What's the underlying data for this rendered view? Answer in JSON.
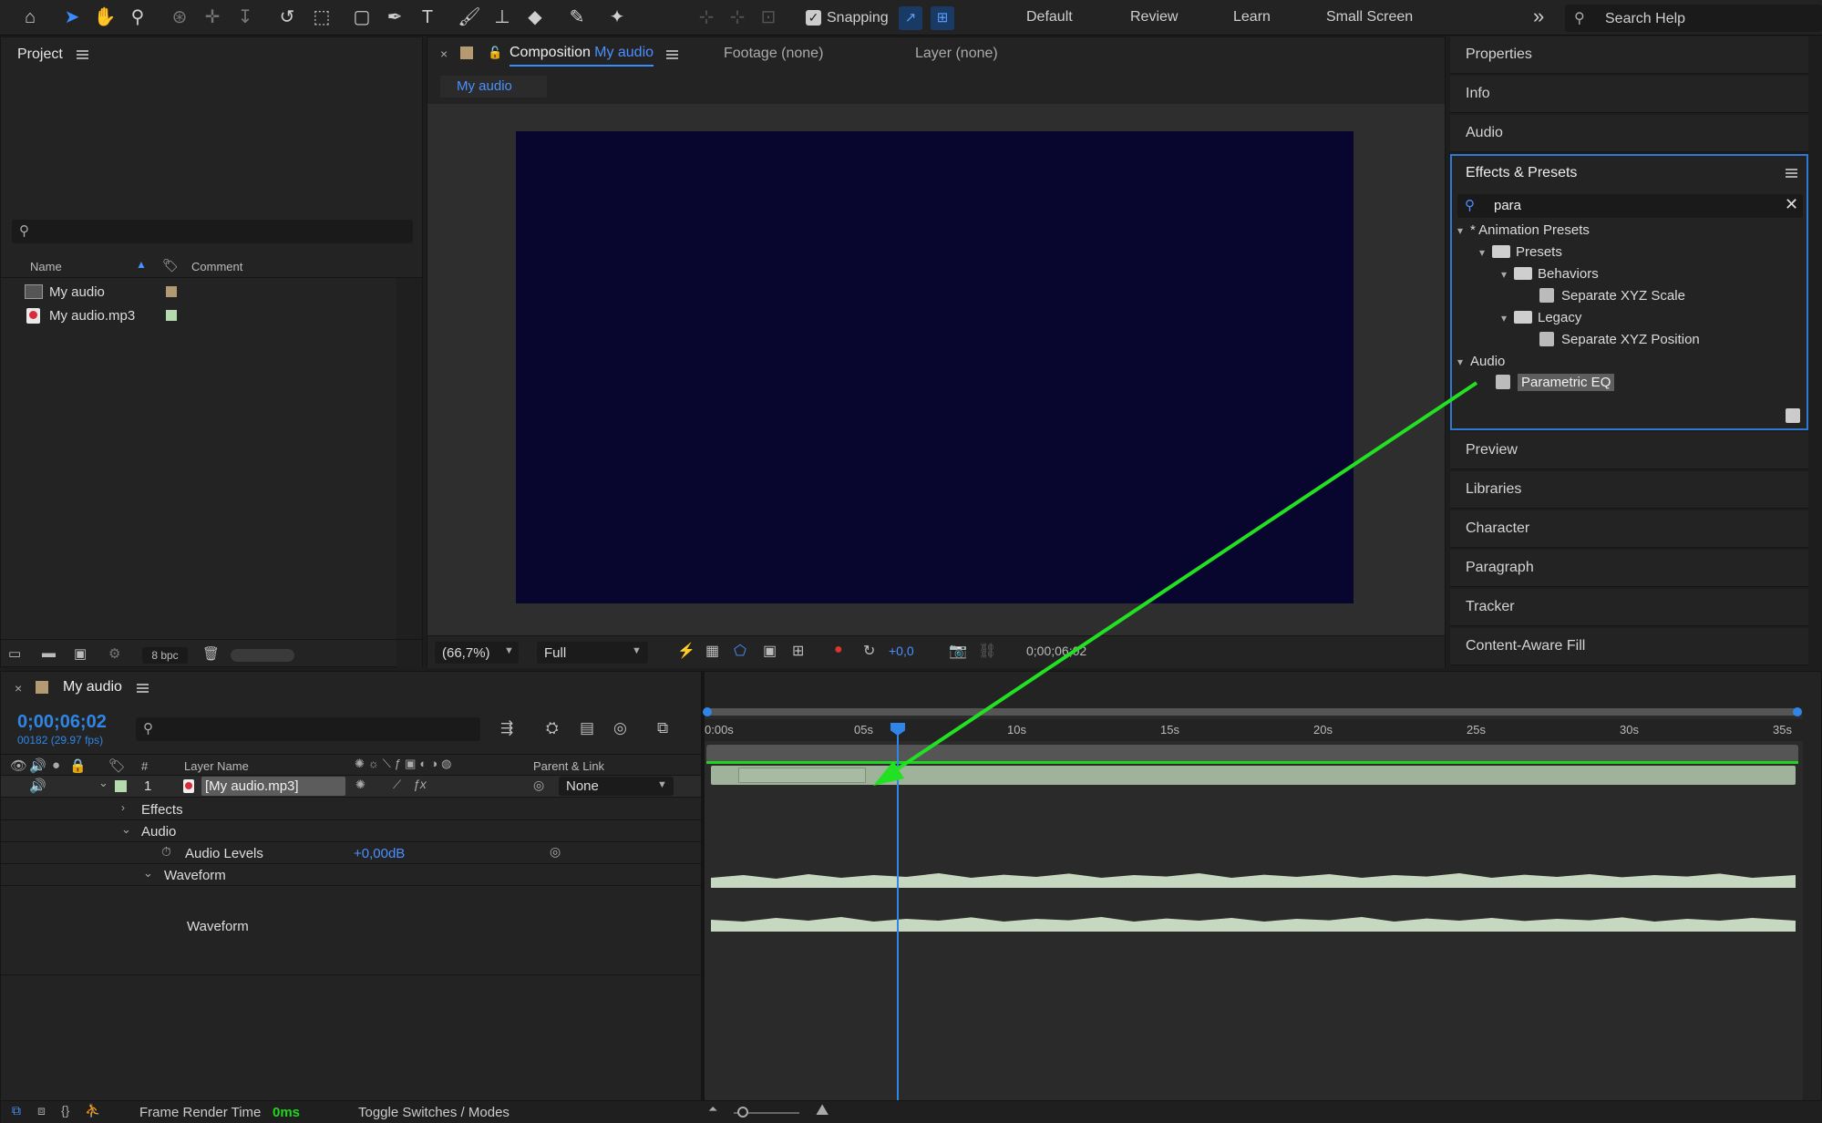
{
  "toolbar": {
    "snapping_label": "Snapping",
    "workspaces": [
      "Default",
      "Review",
      "Learn",
      "Small Screen"
    ],
    "more": "»",
    "search_placeholder": "Search Help"
  },
  "project": {
    "title": "Project",
    "columns": {
      "name": "Name",
      "comment": "Comment"
    },
    "items": [
      {
        "name": "My audio",
        "label_color": "#b39a72"
      },
      {
        "name": "My audio.mp3",
        "label_color": "#b7d9b0"
      }
    ],
    "bpc": "8 bpc"
  },
  "viewer": {
    "tabs": {
      "composition_prefix": "Composition",
      "composition_name": "My audio",
      "footage": "Footage (none)",
      "layer": "Layer (none)"
    },
    "comp_tab": "My audio",
    "zoom": "(66,7%)",
    "resolution": "Full",
    "exposure": "+0,0",
    "timecode": "0;00;06;02",
    "canvas_color": "#08062e"
  },
  "right_panels": {
    "properties": "Properties",
    "info": "Info",
    "audio": "Audio",
    "effects_title": "Effects & Presets",
    "search_value": "para",
    "tree": {
      "animation_presets": "* Animation Presets",
      "presets": "Presets",
      "behaviors": "Behaviors",
      "separate_scale": "Separate XYZ Scale",
      "legacy": "Legacy",
      "separate_position": "Separate XYZ Position",
      "audio": "Audio",
      "parametric_eq": "Parametric EQ"
    },
    "preview": "Preview",
    "libraries": "Libraries",
    "character": "Character",
    "paragraph": "Paragraph",
    "tracker": "Tracker",
    "content_aware": "Content-Aware Fill"
  },
  "timeline": {
    "title": "My audio",
    "timecode": "0;00;06;02",
    "frame_info": "00182 (29.97 fps)",
    "columns": {
      "hash": "#",
      "layer_name": "Layer Name",
      "parent": "Parent & Link"
    },
    "layer": {
      "index": "1",
      "name": "[My audio.mp3]",
      "parent": "None"
    },
    "effects": "Effects",
    "audio": "Audio",
    "audio_levels": "Audio Levels",
    "audio_levels_value": "+0,00dB",
    "waveform_group": "Waveform",
    "waveform_label": "Waveform",
    "ruler": [
      "0:00s",
      "05s",
      "10s",
      "15s",
      "20s",
      "25s",
      "30s",
      "35s"
    ],
    "frame_render_label": "Frame Render Time",
    "frame_render_value": "0ms",
    "toggle_label": "Toggle Switches / Modes"
  },
  "colors": {
    "accent": "#3b8cff",
    "annotation_arrow": "#22e022",
    "timecode": "#2f86e6",
    "waveform": "#c7d8c1"
  }
}
